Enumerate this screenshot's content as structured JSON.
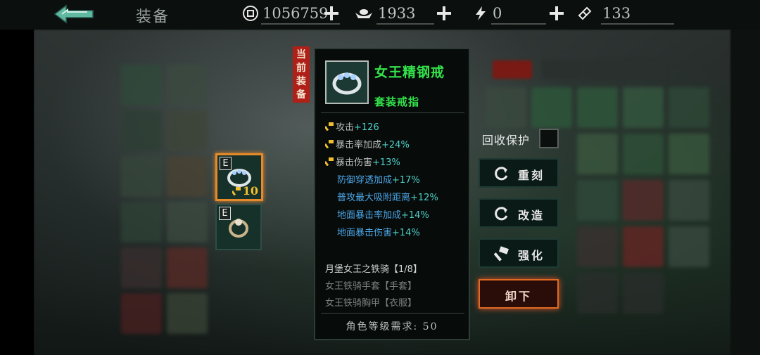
{
  "header": {
    "title": "装备",
    "coins": "1056759",
    "ingots": "1933",
    "energy": "0",
    "tickets": "133"
  },
  "colors": {
    "item_name": "#33e34a",
    "stat_value": "#4fd0c8",
    "sub_stat": "#4da6e6",
    "selected_border": "#e58a2a",
    "current_tag": "#b02018"
  },
  "slots": {
    "slot1_letter": "E",
    "slot1_level": "10",
    "slot2_letter": "E"
  },
  "current_tag": "当前装备",
  "item": {
    "name": "女王精钢戒",
    "type": "套装戒指",
    "main_stats": [
      {
        "label": "攻击",
        "value": "+126"
      },
      {
        "label": "暴击率加成",
        "value": "+24%"
      },
      {
        "label": "暴击伤害",
        "value": "+13%"
      }
    ],
    "sub_stats": [
      {
        "label": "防御穿透加成",
        "value": "+17%"
      },
      {
        "label": "普攻最大吸附距离",
        "value": "+12%"
      },
      {
        "label": "地面暴击率加成",
        "value": "+14%"
      },
      {
        "label": "地面暴击伤害",
        "value": "+14%"
      }
    ],
    "set_title": "月堡女王之铁骑【1/8】",
    "set_items": [
      "女王铁骑手套【手套】",
      "女王铁骑胸甲【衣服】"
    ],
    "requirement": "角色等级需求: 50"
  },
  "actions": {
    "recycle_protect": "回收保护",
    "reforge": "重刻",
    "modify": "改造",
    "enhance": "强化",
    "unequip": "卸下"
  }
}
